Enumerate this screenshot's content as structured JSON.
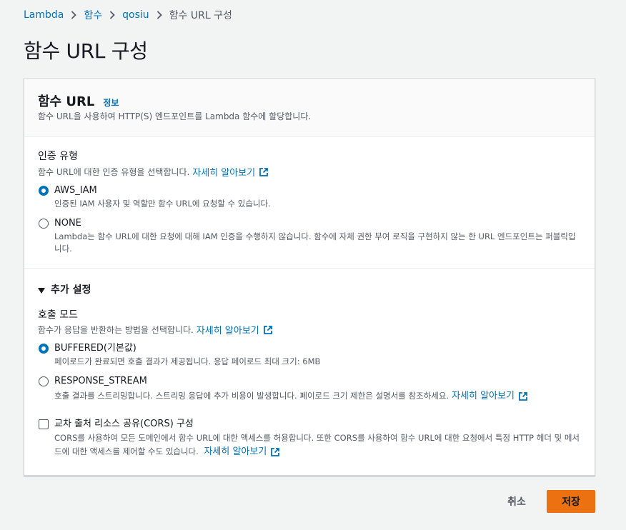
{
  "breadcrumb": {
    "items": [
      "Lambda",
      "함수",
      "qosiu"
    ],
    "current": "함수 URL 구성"
  },
  "page_title": "함수 URL 구성",
  "card": {
    "title": "함수 URL",
    "info_link": "정보",
    "description": "함수 URL을 사용하여 HTTP(S) 엔드포인트를 Lambda 함수에 할당합니다."
  },
  "auth": {
    "label": "인증 유형",
    "description": "함수 URL에 대한 인증 유형을 선택합니다.",
    "learn_more": "자세히 알아보기",
    "options": [
      {
        "label": "AWS_IAM",
        "desc": "인증된 IAM 사용자 및 역할만 함수 URL에 요청할 수 있습니다.",
        "selected": true
      },
      {
        "label": "NONE",
        "desc": "Lambda는 함수 URL에 대한 요청에 대해 IAM 인증을 수행하지 않습니다. 함수에 자체 권한 부여 로직을 구현하지 않는 한 URL 엔드포인트는 퍼블릭입니다.",
        "selected": false
      }
    ]
  },
  "additional": {
    "toggle_label": "추가 설정",
    "invoke_mode": {
      "label": "호출 모드",
      "description": "함수가 응답을 반환하는 방법을 선택합니다.",
      "learn_more": "자세히 알아보기",
      "options": [
        {
          "label": "BUFFERED(기본값)",
          "desc": "페이로드가 완료되면 호출 결과가 제공됩니다. 응답 페이로드 최대 크기: 6MB",
          "selected": true
        },
        {
          "label": "RESPONSE_STREAM",
          "desc": "호출 결과를 스트리밍합니다. 스트리밍 응답에 추가 비용이 발생합니다. 페이로드 크기 제한은 설명서를 참조하세요.",
          "learn_more": "자세히 알아보기",
          "selected": false
        }
      ]
    },
    "cors": {
      "label": "교차 출처 리소스 공유(CORS) 구성",
      "desc": "CORS를 사용하여 모든 도메인에서 함수 URL에 대한 액세스를 허용합니다. 또한 CORS를 사용하여 함수 URL에 대한 요청에서 특정 HTTP 헤더 및 메서드에 대한 액세스를 제어할 수도 있습니다.",
      "learn_more": "자세히 알아보기",
      "checked": false
    }
  },
  "footer": {
    "cancel_label": "취소",
    "save_label": "저장"
  },
  "colors": {
    "link": "#0073bb",
    "primary_button": "#ec7211",
    "background": "#f2f3f3"
  }
}
